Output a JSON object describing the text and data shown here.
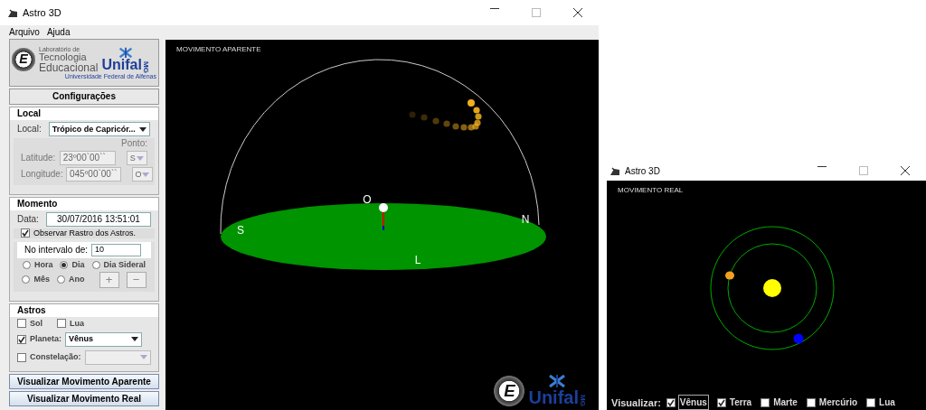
{
  "main_window": {
    "title": "Astro 3D",
    "menu": [
      "Arquivo",
      "Ajuda"
    ],
    "logo": {
      "mark": "E",
      "lab_caption": "Laboratório de",
      "line1": "Tecnologia",
      "line2": "Educacional",
      "brand": "Unifal",
      "brand_suffix": "MG",
      "brand_caption": "Universidade Federal de Alfenas"
    },
    "config_header": "Configurações",
    "local": {
      "heading": "Local",
      "label": "Local:",
      "value": "Trópico de Capricór...",
      "ponto_label": "Ponto:",
      "disabled": true,
      "coords": [
        {
          "label": "Latitude:",
          "value": "23º00`00``",
          "point": "S"
        },
        {
          "label": "Longitude:",
          "value": "045º00`00``",
          "point": "O"
        }
      ]
    },
    "momento": {
      "heading": "Momento",
      "data_label": "Data:",
      "data": "30/07/2016 13:51:01",
      "trail": {
        "label": "Observar Rastro dos Astros.",
        "checked": true
      },
      "interval_label": "No intervalo de:",
      "interval": "10",
      "units": [
        {
          "label": "Hora",
          "selected": false
        },
        {
          "label": "Dia",
          "selected": true
        },
        {
          "label": "Dia Sideral",
          "selected": false
        },
        {
          "label": "Mês",
          "selected": false
        },
        {
          "label": "Ano",
          "selected": false
        }
      ],
      "steps": [
        "+",
        "−"
      ]
    },
    "astros": {
      "heading": "Astros",
      "items": [
        {
          "kind": "check",
          "label": "Sol",
          "checked": false
        },
        {
          "kind": "check",
          "label": "Lua",
          "checked": false
        },
        {
          "kind": "select",
          "label": "Planeta:",
          "checked": true,
          "value": "Vênus"
        },
        {
          "kind": "select",
          "label": "Constelação:",
          "checked": false
        }
      ]
    },
    "buttons": [
      "Visualizar Movimento Aparente",
      "Visualizar Movimento Real"
    ],
    "scene": {
      "title": "MOVIMENTO APARENTE",
      "cardinals": [
        "O",
        "S",
        "N",
        "L"
      ],
      "logo": {
        "mark": "E",
        "brand": "Unifal",
        "brand_suffix": "MG"
      }
    }
  },
  "real_window": {
    "title": "Astro 3D",
    "scene_title": "MOVIMENTO REAL",
    "visualizar_label": "Visualizar:",
    "options": [
      {
        "label": "Vênus",
        "checked": true
      },
      {
        "label": "Terra",
        "checked": true
      },
      {
        "label": "Marte",
        "checked": false
      },
      {
        "label": "Mercúrio",
        "checked": false
      },
      {
        "label": "Lua",
        "checked": false
      }
    ]
  }
}
